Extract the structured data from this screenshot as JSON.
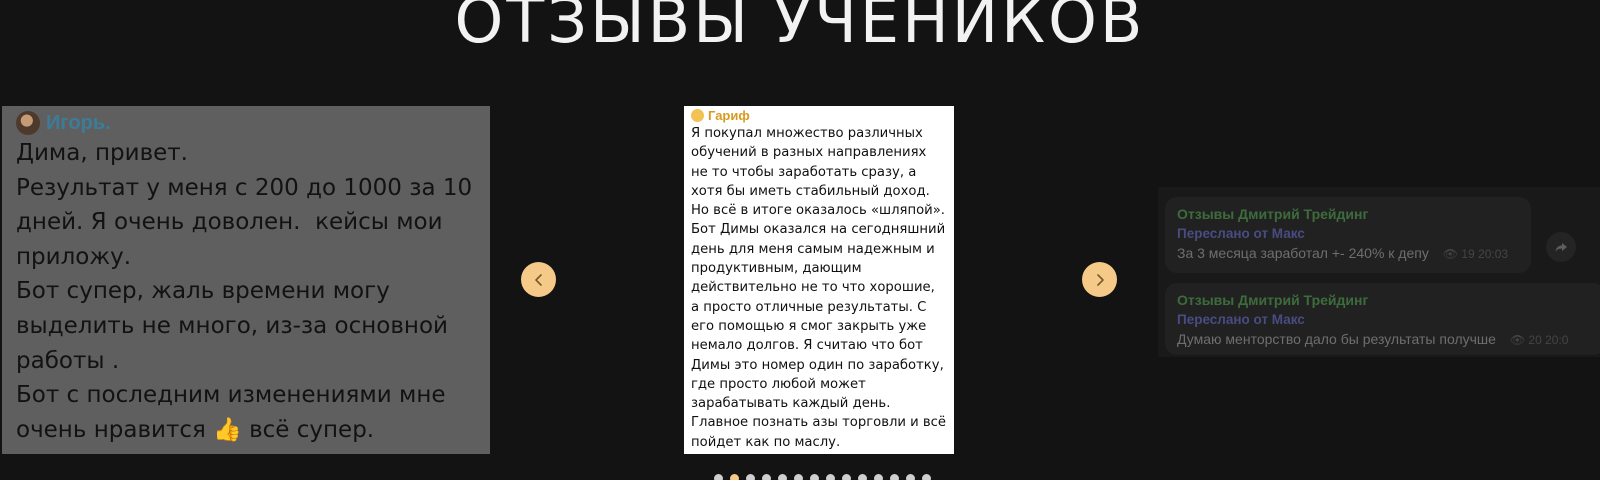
{
  "section": {
    "title": "ОТЗЫВЫ УЧЕНИКОВ"
  },
  "reviews": {
    "left": {
      "author": "Игорь.",
      "text": "Дима, привет.\nРезультат у меня с 200 до 1000 за 10 дней. Я очень доволен.  кейсы мои приложу.\nБот супер, жаль времени могу выделить не много, из-за основной работы .\nБот с последним изменениями мне очень нравится 👍 всё супер."
    },
    "center": {
      "author": "Гариф",
      "text": "Я покупал множество различных обучений в разных направлениях не то чтобы заработать сразу, а хотя бы иметь стабильный доход. Но всё в итоге оказалось «шляпой». Бот Димы оказался на сегодняшний день для меня самым надежным и продуктивным, дающим действительно не то что хорошие, а просто отличные результаты. С его помощью я смог закрыть уже немало долгов. Я считаю что бот Димы это номер один по заработку, где просто любой может зарабатывать каждый день. Главное познать азы торговли и всё пойдет как по маслу."
    },
    "right": {
      "messages": [
        {
          "channel": "Отзывы Дмитрий Трейдинг",
          "forwarded": "Переслано от Макс",
          "text": "За 3 месяца заработал +- 240% к депу",
          "views": "19",
          "time": "20:03"
        },
        {
          "channel": "Отзывы Дмитрий Трейдинг",
          "forwarded": "Переслано от Макс",
          "text": "Думаю менторство дало бы результаты получше",
          "views": "20",
          "time": "20:0"
        }
      ]
    }
  },
  "navigation": {
    "prev_icon": "chevron-left-icon",
    "next_icon": "chevron-right-icon"
  },
  "pagination": {
    "total": 14,
    "active_index": 1
  },
  "colors": {
    "background": "#131313",
    "accent": "#f5c987",
    "title": "#f2f2f2"
  }
}
